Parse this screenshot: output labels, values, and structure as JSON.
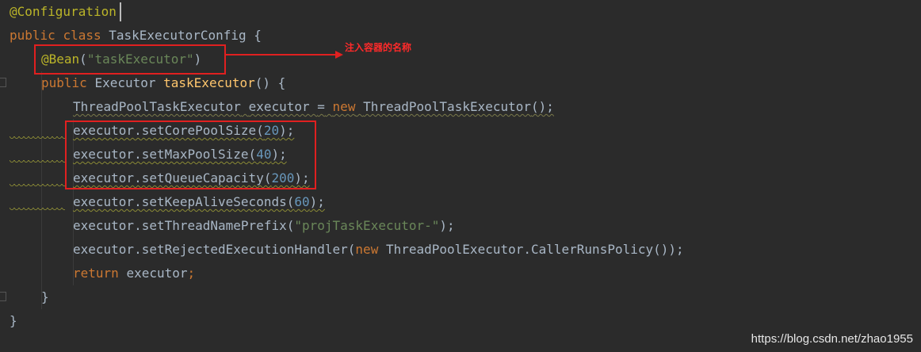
{
  "code": {
    "l1_annotation": "@Configuration",
    "l2_kw_public": "public",
    "l2_kw_class": "class",
    "l2_classname": "TaskExecutorConfig",
    "l2_brace": "{",
    "l3_annotation": "@Bean",
    "l3_paren_open": "(",
    "l3_string": "\"taskExecutor\"",
    "l3_paren_close": ")",
    "l4_kw_public": "public",
    "l4_type": "Executor",
    "l4_method": "taskExecutor",
    "l4_rest": "() {",
    "l5_type": "ThreadPoolTaskExecutor",
    "l5_var": "executor",
    "l5_eq": "=",
    "l5_kw_new": "new",
    "l5_ctor": "ThreadPoolTaskExecutor",
    "l5_end": "();",
    "l6_call": "executor.setCorePoolSize(",
    "l6_num": "20",
    "l6_end": ");",
    "l7_call": "executor.setMaxPoolSize(",
    "l7_num": "40",
    "l7_end": ");",
    "l8_call": "executor.setQueueCapacity(",
    "l8_num": "200",
    "l8_end": ");",
    "l9_call": "executor.setKeepAliveSeconds(",
    "l9_num": "60",
    "l9_end": ");",
    "l10_call": "executor.setThreadNamePrefix(",
    "l10_string": "\"projTaskExecutor-\"",
    "l10_end": ");",
    "l11_call": "executor.setRejectedExecutionHandler(",
    "l11_kw_new": "new",
    "l11_ctor": "ThreadPoolExecutor.CallerRunsPolicy",
    "l11_end": "());",
    "l12_kw_return": "return",
    "l12_var": "executor",
    "l12_semi": ";",
    "l13_brace": "}",
    "l14_brace": "}"
  },
  "callout_text": "注入容器的名称",
  "watermark": "https://blog.csdn.net/zhao1955",
  "colors": {
    "background": "#2b2b2b",
    "annotation": "#bbb529",
    "keyword": "#cc7832",
    "string": "#6a8759",
    "number": "#6897bb",
    "method": "#ffc66d",
    "text": "#a9b7c6",
    "highlight_box": "#e02020"
  }
}
